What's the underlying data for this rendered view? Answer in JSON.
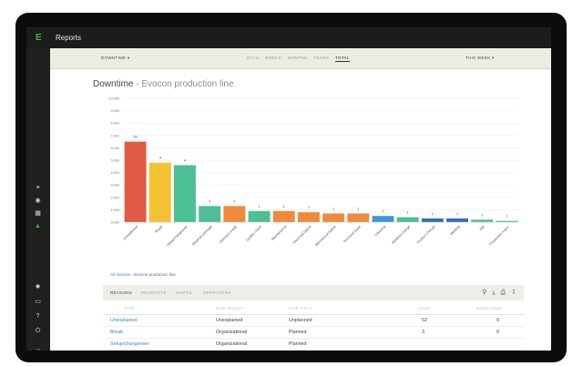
{
  "app": {
    "title": "Reports",
    "logo": "E"
  },
  "sidebar": {
    "icons": [
      "list-icon",
      "target-icon",
      "chart-icon",
      "activity-icon",
      "settings-icon",
      "chat-icon",
      "help-icon",
      "power-icon",
      "logout-icon"
    ]
  },
  "subbar": {
    "left_dropdown": "DOWNTIME ▾",
    "right_dropdown": "THIS WEEK ▾",
    "time_tabs": [
      "DAYS",
      "WEEKS",
      "MONTHS",
      "YEARS",
      "TOTAL"
    ],
    "active_time_tab": "TOTAL"
  },
  "chart": {
    "title": "Downtime",
    "subtitle": "- Evocon production line"
  },
  "chart_data": {
    "type": "bar",
    "title": "Downtime - Evocon production line",
    "ylabel": "",
    "ylim": [
      0,
      10
    ],
    "yticks": [
      "0,00h",
      "1,00h",
      "2,00h",
      "3,00h",
      "4,00h",
      "5,00h",
      "6,00h",
      "7,00h",
      "8,00h",
      "9,00h",
      "10,00h"
    ],
    "categories": [
      "Unexplained",
      "Break",
      "Setup/changeover",
      "Material shortage",
      "Operator break",
      "Quality check",
      "Maintenance",
      "Electrical failure",
      "Mechanical failure",
      "Technical issue",
      "Cleaning",
      "Material change",
      "Product change",
      "Meeting",
      "Idle",
      "Preventive maint."
    ],
    "values": [
      6.5,
      4.8,
      4.6,
      1.3,
      1.3,
      0.9,
      0.9,
      0.8,
      0.7,
      0.7,
      0.5,
      0.4,
      0.3,
      0.3,
      0.2,
      0.1
    ],
    "labels": [
      "52",
      "4",
      "4",
      "2",
      "2",
      "1",
      "1",
      "1",
      "1",
      "1",
      "1",
      "1",
      "1",
      "1",
      "1",
      "1"
    ],
    "colors": [
      "#e05a45",
      "#f2c233",
      "#4dbf94",
      "#4dbf94",
      "#ef8a3c",
      "#4dbf94",
      "#ef8a3c",
      "#ef8a3c",
      "#ef8a3c",
      "#ef8a3c",
      "#3a9ad9",
      "#4dbf94",
      "#2f6fb3",
      "#2f6fb3",
      "#4dbf94",
      "#4dbf94"
    ],
    "grid": true
  },
  "breadcrumb": {
    "root": "All reasons",
    "sep": "›",
    "current": "Evocon production line"
  },
  "table": {
    "tabs": [
      "REASONS",
      "PRODUCTS",
      "SHIFTS",
      "OPERATORS"
    ],
    "active_tab": "REASONS",
    "toolbar_icons": [
      "filter-icon",
      "download-icon",
      "print-icon",
      "export-icon"
    ],
    "columns": [
      "STOP",
      "STOP GROUP ▾",
      "STOP TYPE ▾",
      "COUNT",
      "RATED COUNT"
    ],
    "rows": [
      {
        "stop": "Unexplained",
        "group": "Unexplained",
        "type": "Unplanned",
        "count": "52",
        "rated": "0"
      },
      {
        "stop": "Break",
        "group": "Organizational",
        "type": "Planned",
        "count": "3",
        "rated": "0"
      },
      {
        "stop": "Setup/changeover",
        "group": "Organizational",
        "type": "Planned",
        "count": "",
        "rated": ""
      }
    ]
  }
}
